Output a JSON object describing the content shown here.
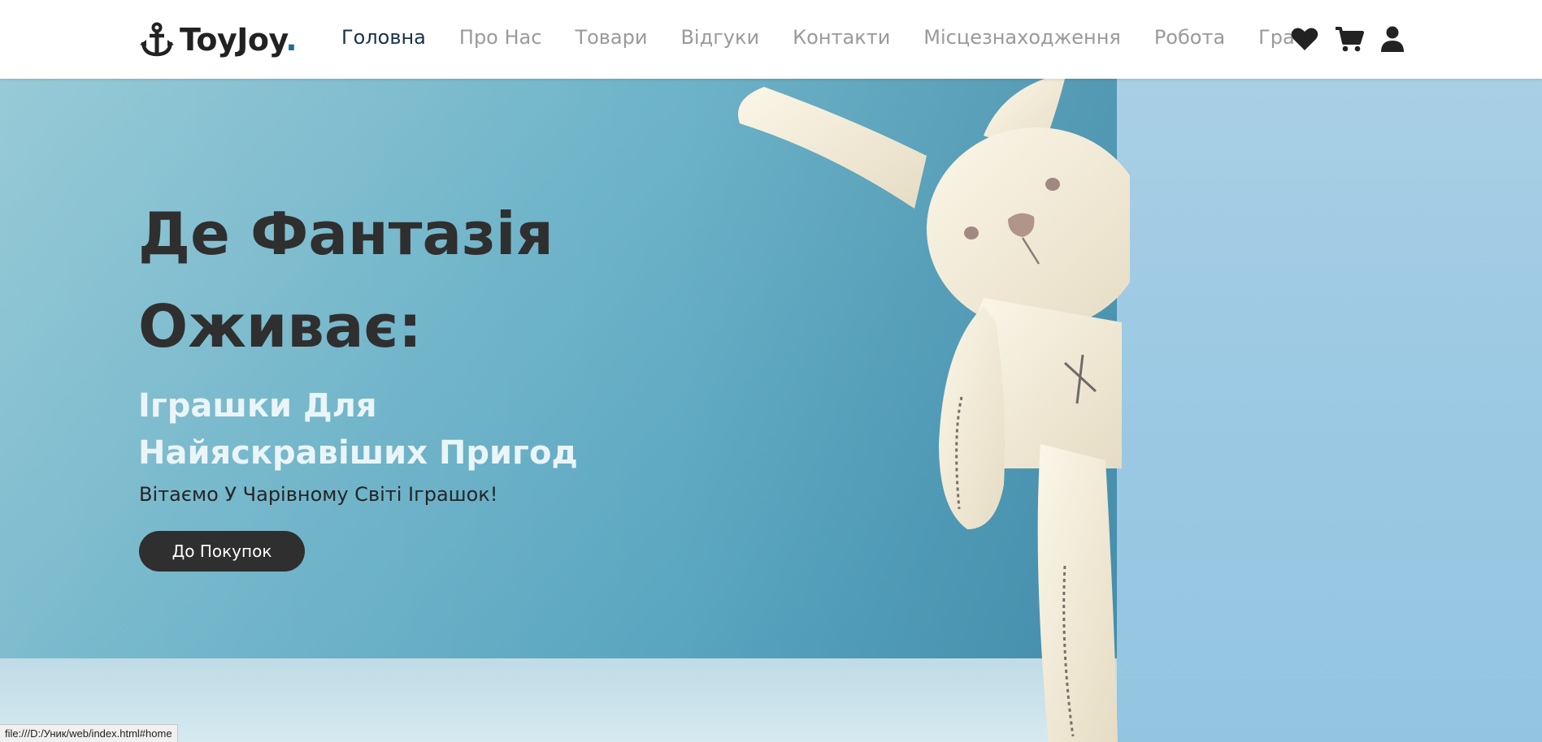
{
  "logo": {
    "name": "ToyJoy",
    "dot": "."
  },
  "nav": [
    {
      "label": "Головна",
      "active": true
    },
    {
      "label": "Про Нас"
    },
    {
      "label": "Товари"
    },
    {
      "label": "Відгуки"
    },
    {
      "label": "Контакти"
    },
    {
      "label": "Місцезнаходження"
    },
    {
      "label": "Робота"
    },
    {
      "label": "Гра"
    }
  ],
  "header_icons": [
    "heart-icon",
    "cart-icon",
    "user-icon"
  ],
  "hero": {
    "title": "Де Фантазія Оживає:",
    "subtitle": "Іграшки Для Найяскравіших Пригод",
    "text": "Вітаємо У Чарівному Світі Іграшок!",
    "button": "До Покупок"
  },
  "status_bar": {
    "url": "file:///D:/Уник/web/index.html#home"
  },
  "colors": {
    "dark": "#2f2f2f",
    "nav_active": "#19324a",
    "nav_inactive": "#9a9a9a",
    "hero_bg": "#55a2be"
  }
}
